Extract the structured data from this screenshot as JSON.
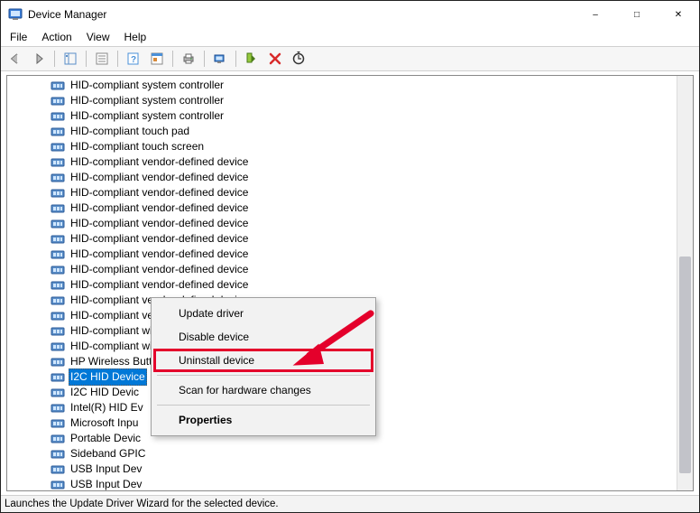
{
  "window": {
    "title": "Device Manager"
  },
  "menu": {
    "file": "File",
    "action": "Action",
    "view": "View",
    "help": "Help"
  },
  "toolbar_icons": [
    "back-icon",
    "forward-icon",
    "show-hide-console-tree-icon",
    "properties-icon",
    "help-icon",
    "toolbox-icon",
    "print-icon",
    "monitor-icon",
    "update-driver-icon",
    "uninstall-icon",
    "scan-hardware-icon"
  ],
  "devices": [
    {
      "label": "HID-compliant system controller",
      "selected": false,
      "truncated": false
    },
    {
      "label": "HID-compliant system controller",
      "selected": false,
      "truncated": false
    },
    {
      "label": "HID-compliant system controller",
      "selected": false,
      "truncated": false
    },
    {
      "label": "HID-compliant touch pad",
      "selected": false,
      "truncated": false
    },
    {
      "label": "HID-compliant touch screen",
      "selected": false,
      "truncated": false
    },
    {
      "label": "HID-compliant vendor-defined device",
      "selected": false,
      "truncated": false
    },
    {
      "label": "HID-compliant vendor-defined device",
      "selected": false,
      "truncated": false
    },
    {
      "label": "HID-compliant vendor-defined device",
      "selected": false,
      "truncated": false
    },
    {
      "label": "HID-compliant vendor-defined device",
      "selected": false,
      "truncated": false
    },
    {
      "label": "HID-compliant vendor-defined device",
      "selected": false,
      "truncated": false
    },
    {
      "label": "HID-compliant vendor-defined device",
      "selected": false,
      "truncated": false
    },
    {
      "label": "HID-compliant vendor-defined device",
      "selected": false,
      "truncated": false
    },
    {
      "label": "HID-compliant vendor-defined device",
      "selected": false,
      "truncated": false
    },
    {
      "label": "HID-compliant vendor-defined device",
      "selected": false,
      "truncated": false
    },
    {
      "label": "HID-compliant vendor-defined device",
      "selected": false,
      "truncated": false
    },
    {
      "label": "HID-compliant vendor-defined device",
      "selected": false,
      "truncated": false
    },
    {
      "label": "HID-compliant wireless radio controls",
      "selected": false,
      "truncated": false
    },
    {
      "label": "HID-compliant wireless radio controls",
      "selected": false,
      "truncated": false
    },
    {
      "label": "HP Wireless Button Driver",
      "selected": false,
      "truncated": false
    },
    {
      "label": "I2C HID Device",
      "selected": true,
      "truncated": false
    },
    {
      "label": "I2C HID Devic",
      "selected": false,
      "truncated": true
    },
    {
      "label": "Intel(R) HID Ev",
      "selected": false,
      "truncated": true
    },
    {
      "label": "Microsoft Inpu",
      "selected": false,
      "truncated": true
    },
    {
      "label": "Portable Devic",
      "selected": false,
      "truncated": true
    },
    {
      "label": "Sideband GPIC",
      "selected": false,
      "truncated": true
    },
    {
      "label": "USB Input Dev",
      "selected": false,
      "truncated": true
    },
    {
      "label": "USB Input Dev",
      "selected": false,
      "truncated": true
    }
  ],
  "context_menu": {
    "update": "Update driver",
    "disable": "Disable device",
    "uninstall": "Uninstall device",
    "scan": "Scan for hardware changes",
    "properties": "Properties"
  },
  "statusbar": {
    "text": "Launches the Update Driver Wizard for the selected device."
  }
}
